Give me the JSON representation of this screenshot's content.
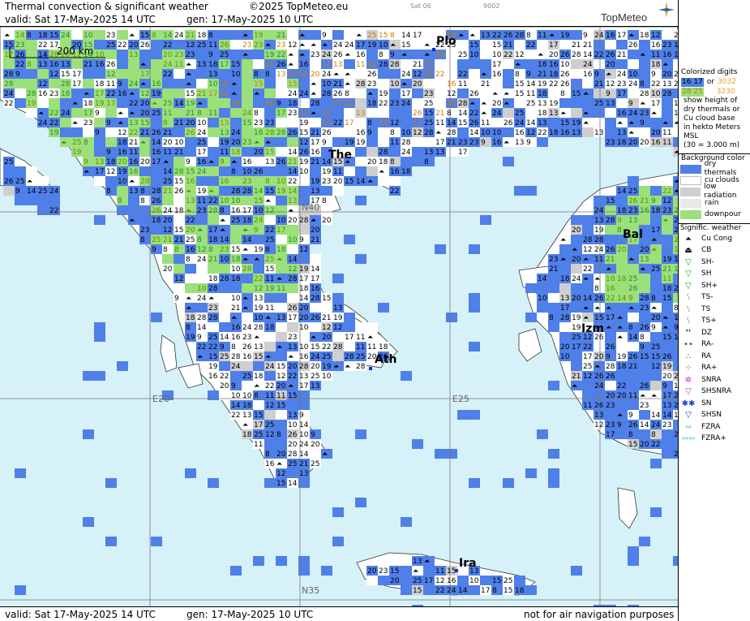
{
  "header": {
    "title": "Thermal convection & significant weather",
    "copyright": "©2025 TopMeteo.eu",
    "satellite": "Sat 06",
    "code": "9002",
    "valid": "valid:  Sat  17-May-2025  14 UTC",
    "generated": "gen: 17-May-2025 10 UTC",
    "brand": "TopMeteo"
  },
  "footer": {
    "valid": "valid:  Sat  17-May-2025  14 UTC",
    "generated": "gen: 17-May-2025 10 UTC",
    "disclaimer": "not for air navigation purposes"
  },
  "map": {
    "scale_label": "200 km",
    "city_labels": [
      "Plo",
      "The",
      "Bal",
      "Izm",
      "Ath",
      "Ira"
    ],
    "grid_labels": [
      "N40",
      "E20",
      "E25",
      "N35"
    ]
  },
  "legend": {
    "colorized_title": "Colorized digits",
    "sample_a": "16 17",
    "sample_or": "or",
    "sample_b": "3032",
    "sample_c": "28 25",
    "sample_d": "3230",
    "desc_lines": [
      "show height of",
      "dry thermals or",
      "Cu cloud base",
      "in hekto Meters",
      "MSL",
      "(30 = 3.000 m)"
    ],
    "background_title": "Background color",
    "background_items": [
      {
        "label": "dry thermals",
        "color": "#4f7fe8"
      },
      {
        "label": "cu clouds",
        "color": "#ffffff"
      },
      {
        "label": "low radiation",
        "color": "#cfcfcf"
      },
      {
        "label": "rain",
        "color": "#e9e9e9"
      },
      {
        "label": "downpour",
        "color": "#9be07a"
      }
    ],
    "weather_title": "Signific. weather",
    "weather_items": [
      {
        "label": "Cu Cong",
        "icon": "cu-cong-icon",
        "glyph": "⏶",
        "color": "#000000"
      },
      {
        "label": "CB",
        "icon": "cb-icon",
        "glyph": "⏏",
        "color": "#000000"
      },
      {
        "label": "SH-",
        "icon": "shower-light-icon",
        "glyph": "▽",
        "color": "#2a9d2a"
      },
      {
        "label": "SH",
        "icon": "shower-icon",
        "glyph": "▽",
        "color": "#2a9d2a"
      },
      {
        "label": "SH+",
        "icon": "shower-heavy-icon",
        "glyph": "▽",
        "color": "#2a9d2a"
      },
      {
        "label": "TS-",
        "icon": "thunderstorm-light-icon",
        "glyph": "ᛊ",
        "color": "#d02020"
      },
      {
        "label": "TS",
        "icon": "thunderstorm-icon",
        "glyph": "ᛊ",
        "color": "#d02020"
      },
      {
        "label": "TS+",
        "icon": "thunderstorm-heavy-icon",
        "glyph": "ᛊ",
        "color": "#d02020"
      },
      {
        "label": "DZ",
        "icon": "drizzle-icon",
        "glyph": "❜❜",
        "color": "#1a6b1a"
      },
      {
        "label": "RA-",
        "icon": "rain-light-icon",
        "glyph": "••",
        "color": "#1a6b1a"
      },
      {
        "label": "RA",
        "icon": "rain-icon",
        "glyph": "∴",
        "color": "#1a6b1a"
      },
      {
        "label": "RA+",
        "icon": "rain-heavy-icon",
        "glyph": "⁘",
        "color": "#1a6b1a"
      },
      {
        "label": "SNRA",
        "icon": "snow-rain-icon",
        "glyph": "✲",
        "color": "#c030c0"
      },
      {
        "label": "SHSNRA",
        "icon": "shower-snow-rain-icon",
        "glyph": "▽",
        "color": "#c030c0"
      },
      {
        "label": "SN",
        "icon": "snow-icon",
        "glyph": "✱✱",
        "color": "#2040d0"
      },
      {
        "label": "SHSN",
        "icon": "shower-snow-icon",
        "glyph": "▽",
        "color": "#2040d0"
      },
      {
        "label": "FZRA",
        "icon": "freezing-rain-icon",
        "glyph": "∾",
        "color": "#30c0d0"
      },
      {
        "label": "FZRA+",
        "icon": "freezing-rain-heavy-icon",
        "glyph": "∾∾",
        "color": "#30c0d0"
      }
    ]
  },
  "sample_values": [
    "17",
    "14",
    "22",
    "16",
    "18",
    "20",
    "23",
    "19",
    "21",
    "15",
    "13",
    "12",
    "11",
    "10",
    "9",
    "8",
    "25",
    "28",
    "26",
    "24"
  ]
}
